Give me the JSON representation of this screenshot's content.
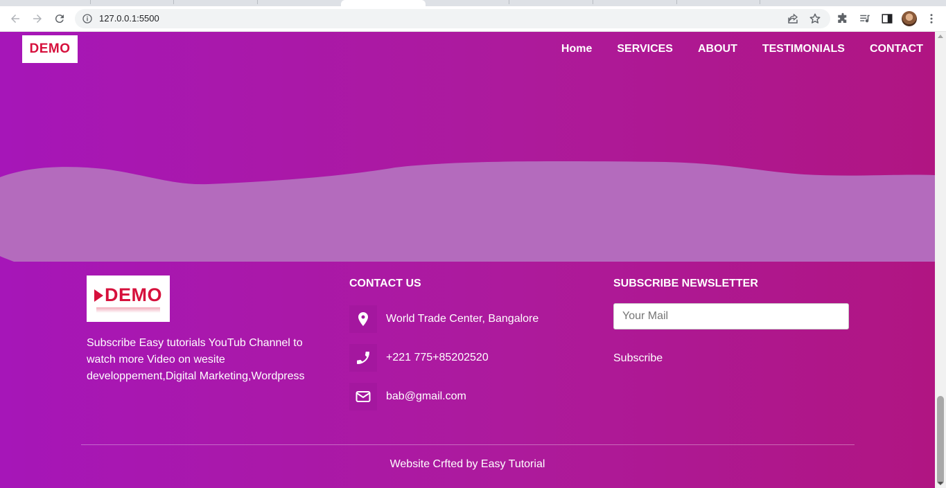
{
  "browser": {
    "url": "127.0.0.1:5500",
    "icons": [
      "back-icon",
      "forward-icon",
      "reload-icon",
      "info-icon",
      "share-icon",
      "star-icon",
      "extensions-icon",
      "media-icon",
      "sidepanel-icon",
      "avatar",
      "menu-icon"
    ]
  },
  "header": {
    "logo_text": "DEMO",
    "nav": [
      "Home",
      "SERVICES",
      "ABOUT",
      "TESTIMONIALS",
      "CONTACT"
    ]
  },
  "footer": {
    "logo_text": "DEMO",
    "about": "Subscribe Easy tutorials YouTub Channel to watch more Video on wesite developpement,Digital Marketing,Wordpress",
    "contact_title": "CONTACT US",
    "address": "World Trade Center, Bangalore",
    "phone": "+221 775+85202520",
    "email": "bab@gmail.com",
    "newsletter_title": "SUBSCRIBE NEWSLETTER",
    "mail_placeholder": "Your Mail",
    "subscribe_label": "Subscribe",
    "credit": "Website Crfted by Easy Tutorial"
  },
  "colors": {
    "gradient_start": "#a616b8",
    "gradient_end": "#b01582",
    "wave": "#b46bbd",
    "logo_red": "#d6103c",
    "icon_bg": "#a4179f"
  }
}
